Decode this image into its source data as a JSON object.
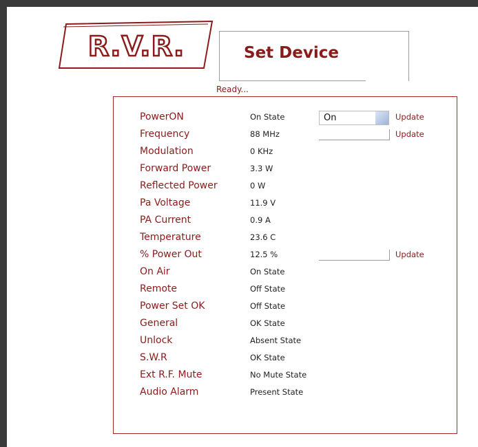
{
  "header": {
    "logo_text": "R.V.R.",
    "title": "Set Device",
    "status": "Ready..."
  },
  "colors": {
    "accent": "#8b1a1a",
    "frame": "#3a3a3a"
  },
  "rows": [
    {
      "label": "PowerON",
      "value": "On  State"
    },
    {
      "label": "Frequency",
      "value": "88  MHz"
    },
    {
      "label": "Modulation",
      "value": "0  KHz"
    },
    {
      "label": "Forward Power",
      "value": "3.3  W"
    },
    {
      "label": "Reflected Power",
      "value": "0  W"
    },
    {
      "label": "Pa Voltage",
      "value": "11.9  V"
    },
    {
      "label": "PA Current",
      "value": "0.9  A"
    },
    {
      "label": "Temperature",
      "value": "23.6  C"
    },
    {
      "label": "% Power Out",
      "value": "12.5  %"
    },
    {
      "label": "On Air",
      "value": "On  State"
    },
    {
      "label": "Remote",
      "value": "Off  State"
    },
    {
      "label": "Power Set OK",
      "value": "Off  State"
    },
    {
      "label": "General",
      "value": "OK  State"
    },
    {
      "label": "Unlock",
      "value": "Absent  State"
    },
    {
      "label": "S.W.R",
      "value": "OK  State"
    },
    {
      "label": "Ext R.F. Mute",
      "value": "No Mute  State"
    },
    {
      "label": "Audio Alarm",
      "value": "Present  State"
    }
  ],
  "controls": {
    "power_select_value": "On",
    "update_label": "Update"
  }
}
